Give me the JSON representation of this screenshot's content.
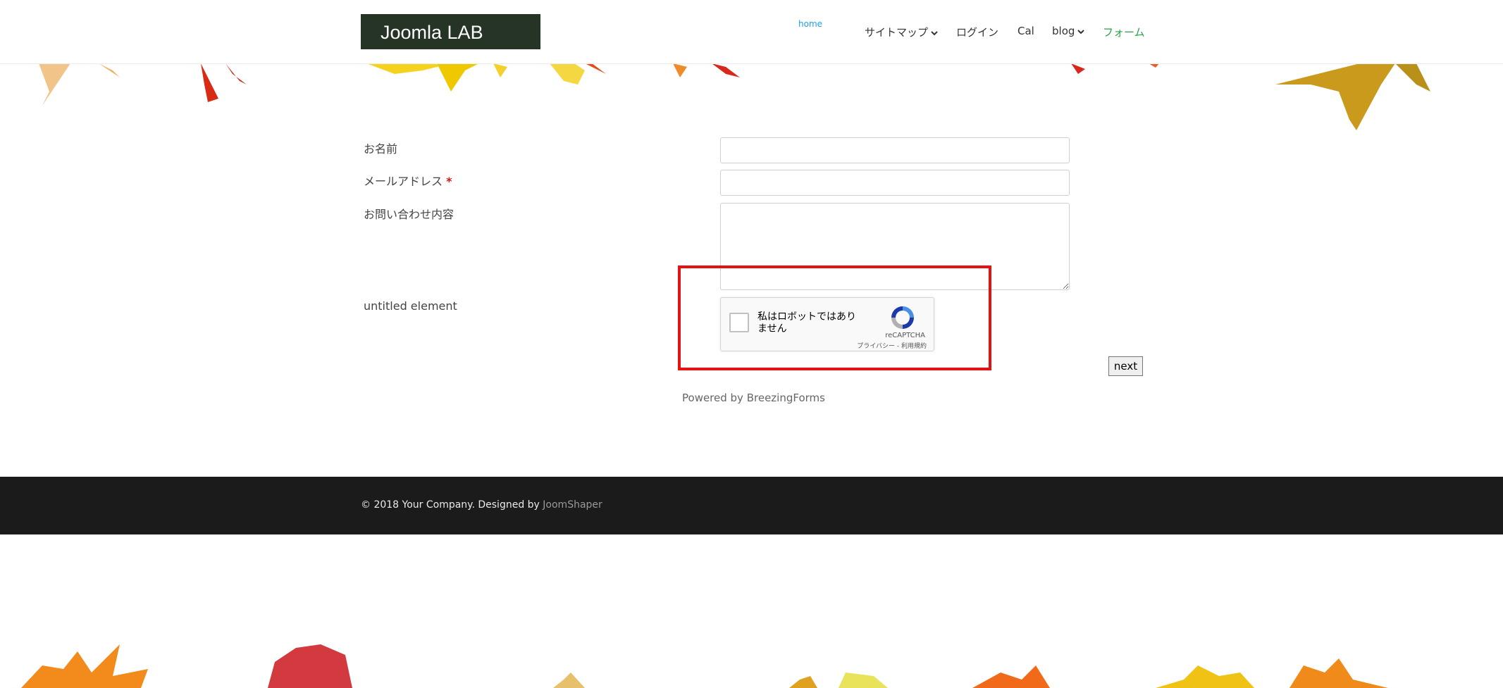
{
  "header": {
    "logo_text": "Joomla LAB",
    "nav": [
      {
        "label": "home"
      },
      {
        "label": "サイトマップ"
      },
      {
        "label": "ログイン"
      },
      {
        "label": "Cal"
      },
      {
        "label": "blog"
      },
      {
        "label": "フォーム"
      }
    ],
    "colors": {
      "home": "#1aa3e8",
      "active": "#2aa14a",
      "logo_bg": "#263426"
    }
  },
  "form": {
    "labels": {
      "name": "お名前",
      "email": "メールアドレス",
      "required_mark": "*",
      "message": "お問い合わせ内容",
      "untitled": "untitled element"
    },
    "values": {
      "name": "",
      "email": "",
      "message": ""
    },
    "recaptcha": {
      "text": "私はロボットではありません",
      "brand": "reCAPTCHA",
      "links": "プライバシー - 利用規約",
      "checked": false
    },
    "next_label": "next",
    "powered_by": "Powered by BreezingForms"
  },
  "footer": {
    "text": "© 2018 Your Company. Designed by",
    "link_label": "JoomShaper",
    "bg": "#1b1b1b"
  }
}
